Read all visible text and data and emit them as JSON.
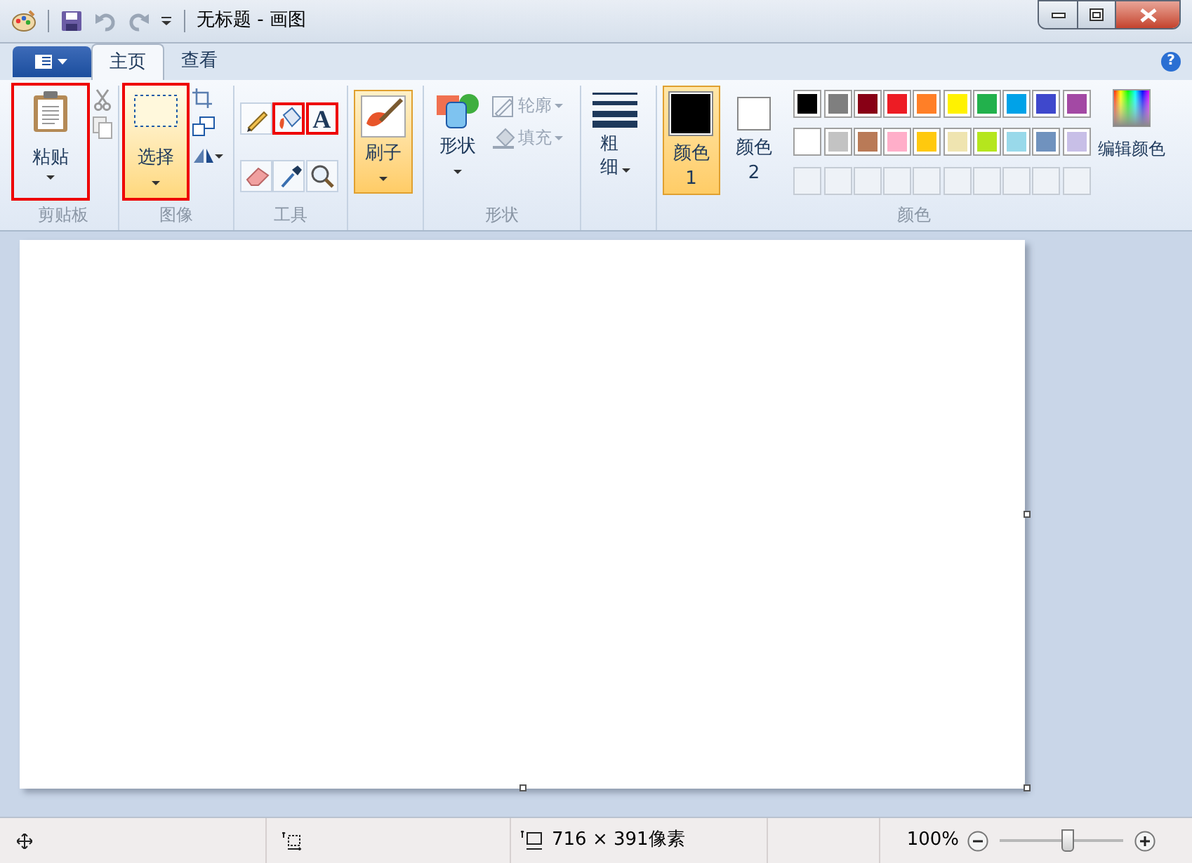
{
  "window": {
    "title": "无标题 - 画图"
  },
  "help": "?",
  "tabs": [
    {
      "label": "主页",
      "selected": true
    },
    {
      "label": "查看",
      "selected": false
    }
  ],
  "ribbon": {
    "clipboard": {
      "label": "剪贴板",
      "paste": {
        "label": "粘贴",
        "highlighted": true
      }
    },
    "image": {
      "label": "图像",
      "select": {
        "label": "选择",
        "highlighted": true,
        "active": true
      }
    },
    "tools": {
      "label": "工具",
      "items": [
        {
          "kind": "pencil",
          "highlighted": false
        },
        {
          "kind": "fill",
          "highlighted": true
        },
        {
          "kind": "text",
          "highlighted": true,
          "glyph": "A"
        },
        {
          "kind": "eraser",
          "highlighted": false
        },
        {
          "kind": "picker",
          "highlighted": false
        },
        {
          "kind": "magnifier",
          "highlighted": false
        }
      ]
    },
    "brushes": {
      "label": "刷子",
      "selected": true
    },
    "shapes": {
      "label": "形状",
      "button": "形状",
      "options": [
        {
          "kind": "outline",
          "label": "轮廓",
          "disabled": true
        },
        {
          "kind": "fill",
          "label": "填充",
          "disabled": true
        }
      ]
    },
    "size": {
      "label": "粗细"
    },
    "colors": {
      "label": "颜色",
      "slots": [
        {
          "label": "颜色 1",
          "selected": true,
          "color": "#000000"
        },
        {
          "label": "颜色 2",
          "selected": false,
          "color": "#ffffff"
        }
      ],
      "palette": [
        {
          "color": "#000000"
        },
        {
          "color": "#7f7f7f"
        },
        {
          "color": "#880015"
        },
        {
          "color": "#ed1c24"
        },
        {
          "color": "#ff7f27"
        },
        {
          "color": "#fff200"
        },
        {
          "color": "#22b14c"
        },
        {
          "color": "#00a2e8"
        },
        {
          "color": "#3f48cc"
        },
        {
          "color": "#a349a4"
        },
        {
          "color": "#ffffff"
        },
        {
          "color": "#c3c3c3"
        },
        {
          "color": "#b97a57"
        },
        {
          "color": "#ffaec9"
        },
        {
          "color": "#ffc90e"
        },
        {
          "color": "#efe4b0"
        },
        {
          "color": "#b5e61d"
        },
        {
          "color": "#99d9ea"
        },
        {
          "color": "#7092be"
        },
        {
          "color": "#c8bfe7"
        }
      ],
      "edit": "编辑颜色"
    }
  },
  "status_bar": {
    "size": "716 × 391像素",
    "zoom": "100%",
    "zoom_slider": {
      "level": 0.55
    }
  }
}
